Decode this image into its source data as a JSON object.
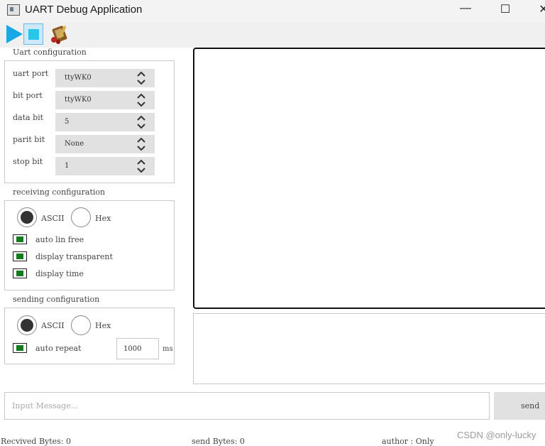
{
  "window": {
    "title": "UART Debug Application",
    "minimize_label": "—",
    "maximize_label": "☐",
    "close_label": "✕"
  },
  "toolbar": {
    "buttons": [
      {
        "icon": "play-icon",
        "color": "#19a8e6"
      },
      {
        "icon": "stop-icon",
        "color": "#28c6e8"
      },
      {
        "icon": "tools-icon",
        "color": "#8a5a1e"
      }
    ]
  },
  "uart_config": {
    "title": "Uart configuration",
    "fields": [
      {
        "label": "uart port",
        "value": "ttyWK0"
      },
      {
        "label": "bit port",
        "value": "ttyWK0"
      },
      {
        "label": "data bit",
        "value": "5"
      },
      {
        "label": "parit bit",
        "value": "None"
      },
      {
        "label": "stop bit",
        "value": "1"
      }
    ]
  },
  "receiving_config": {
    "title": "receiving configuration",
    "ascii_label": "ASCII",
    "hex_label": "Hex",
    "selected": "ASCII",
    "options": [
      {
        "label": "auto lin free",
        "checked": true
      },
      {
        "label": "display transparent",
        "checked": true
      },
      {
        "label": "display time",
        "checked": true
      }
    ]
  },
  "sending_config": {
    "title": "sending configuration",
    "ascii_label": "ASCII",
    "hex_label": "Hex",
    "selected": "ASCII",
    "auto_repeat_label": "auto repeat",
    "auto_repeat_checked": true,
    "interval_value": "1000",
    "interval_unit": "ms"
  },
  "message": {
    "placeholder": "Input Message...",
    "send_label": "send"
  },
  "status": {
    "received": "Recvived Bytes: 0",
    "sent": "send Bytes: 0",
    "author": "author : Only"
  },
  "watermark": "CSDN @only-lucky",
  "colors": {
    "checkbox_fill": "#137b1e",
    "radio_fill": "#333333",
    "toolbar_bg": "#f0f0f0",
    "combo_bg": "#e1e1e1"
  }
}
